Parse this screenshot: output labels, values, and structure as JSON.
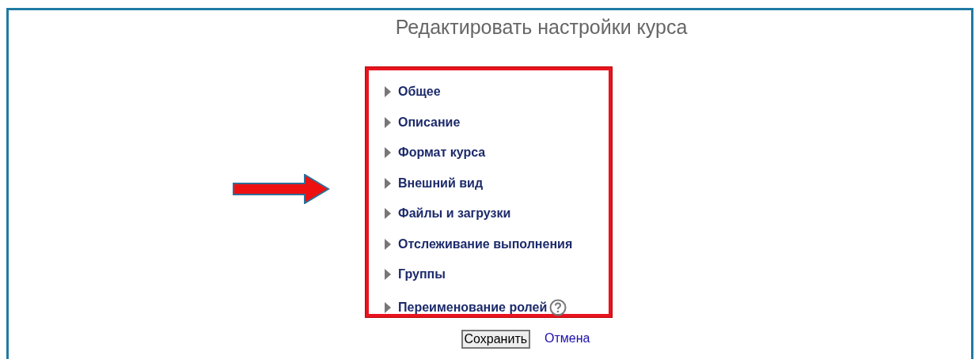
{
  "page_title": "Редактировать настройки курса",
  "sections": [
    {
      "label": "Общее",
      "expanded": false,
      "help": false
    },
    {
      "label": "Описание",
      "expanded": false,
      "help": false
    },
    {
      "label": "Формат курса",
      "expanded": false,
      "help": false
    },
    {
      "label": "Внешний вид",
      "expanded": false,
      "help": false
    },
    {
      "label": "Файлы и загрузки",
      "expanded": false,
      "help": false
    },
    {
      "label": "Отслеживание выполнения",
      "expanded": false,
      "help": false
    },
    {
      "label": "Группы",
      "expanded": false,
      "help": false
    },
    {
      "label": "Переименование ролей",
      "expanded": false,
      "help": true
    }
  ],
  "buttons": {
    "save": "Сохранить",
    "cancel": "Отмена"
  }
}
